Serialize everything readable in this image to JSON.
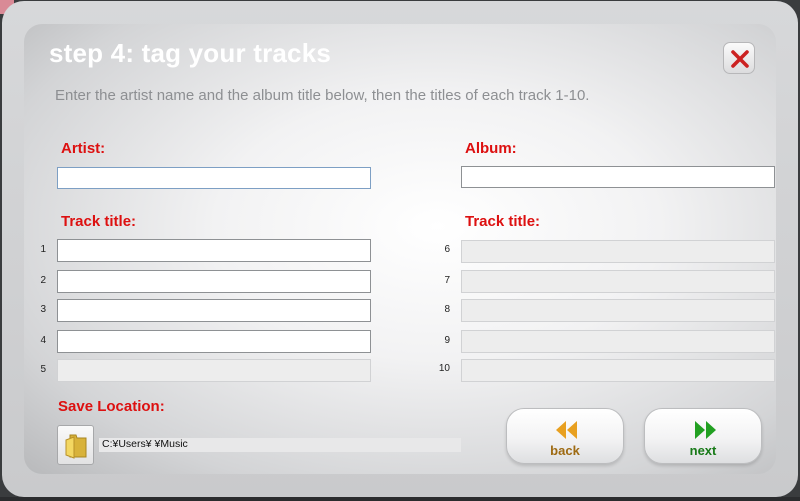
{
  "dialog": {
    "title": "step 4: tag your tracks",
    "instructions": "Enter the artist name and the album title below, then the titles of each track 1-10."
  },
  "artist": {
    "label": "Artist:",
    "value": ""
  },
  "album": {
    "label": "Album:",
    "value": ""
  },
  "track_title_label": "Track title:",
  "tracks": [
    {
      "number": "1",
      "value": "",
      "enabled": true
    },
    {
      "number": "2",
      "value": "",
      "enabled": true
    },
    {
      "number": "3",
      "value": "",
      "enabled": true
    },
    {
      "number": "4",
      "value": "",
      "enabled": true
    },
    {
      "number": "5",
      "value": "",
      "enabled": false
    },
    {
      "number": "6",
      "value": "",
      "enabled": false
    },
    {
      "number": "7",
      "value": "",
      "enabled": false
    },
    {
      "number": "8",
      "value": "",
      "enabled": false
    },
    {
      "number": "9",
      "value": "",
      "enabled": false
    },
    {
      "number": "10",
      "value": "",
      "enabled": false
    }
  ],
  "save_location": {
    "label": "Save Location:",
    "path": "C:¥Users¥        ¥Music",
    "icon": "folder-icon"
  },
  "buttons": {
    "back": {
      "label": "back",
      "icon": "rewind-icon",
      "color": "#e8a020"
    },
    "next": {
      "label": "next",
      "icon": "fast-forward-icon",
      "color": "#22a022"
    }
  },
  "close": {
    "icon": "close-icon",
    "color": "#cc2222"
  },
  "colors": {
    "label_red": "#dd1010",
    "title_white": "#ffffff",
    "instruction_gray": "#8d8f92"
  }
}
